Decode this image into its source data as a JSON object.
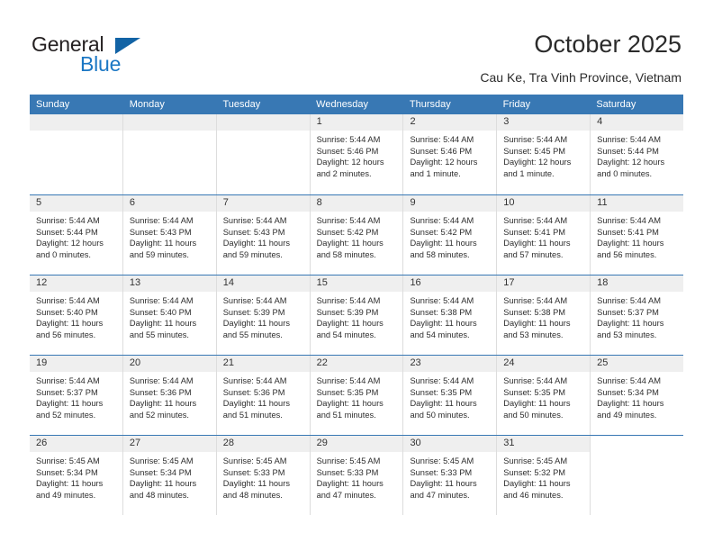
{
  "brand": {
    "name_part1": "General",
    "name_part2": "Blue",
    "triangle_icon": "triangle-icon",
    "accent_color": "#1b77c4"
  },
  "header": {
    "title": "October 2025",
    "subtitle": "Cau Ke, Tra Vinh Province, Vietnam"
  },
  "calendar": {
    "header_bg_color": "#3878b4",
    "date_band_color": "#efefef",
    "weekday_headers": [
      "Sunday",
      "Monday",
      "Tuesday",
      "Wednesday",
      "Thursday",
      "Friday",
      "Saturday"
    ],
    "weeks": [
      [
        {
          "day": "",
          "empty": true,
          "shaded": true
        },
        {
          "day": "",
          "empty": true,
          "shaded": true
        },
        {
          "day": "",
          "empty": true,
          "shaded": true
        },
        {
          "day": "1",
          "sunrise": "Sunrise: 5:44 AM",
          "sunset": "Sunset: 5:46 PM",
          "daylight": "Daylight: 12 hours and 2 minutes."
        },
        {
          "day": "2",
          "sunrise": "Sunrise: 5:44 AM",
          "sunset": "Sunset: 5:46 PM",
          "daylight": "Daylight: 12 hours and 1 minute."
        },
        {
          "day": "3",
          "sunrise": "Sunrise: 5:44 AM",
          "sunset": "Sunset: 5:45 PM",
          "daylight": "Daylight: 12 hours and 1 minute."
        },
        {
          "day": "4",
          "sunrise": "Sunrise: 5:44 AM",
          "sunset": "Sunset: 5:44 PM",
          "daylight": "Daylight: 12 hours and 0 minutes."
        }
      ],
      [
        {
          "day": "5",
          "sunrise": "Sunrise: 5:44 AM",
          "sunset": "Sunset: 5:44 PM",
          "daylight": "Daylight: 12 hours and 0 minutes."
        },
        {
          "day": "6",
          "sunrise": "Sunrise: 5:44 AM",
          "sunset": "Sunset: 5:43 PM",
          "daylight": "Daylight: 11 hours and 59 minutes."
        },
        {
          "day": "7",
          "sunrise": "Sunrise: 5:44 AM",
          "sunset": "Sunset: 5:43 PM",
          "daylight": "Daylight: 11 hours and 59 minutes."
        },
        {
          "day": "8",
          "sunrise": "Sunrise: 5:44 AM",
          "sunset": "Sunset: 5:42 PM",
          "daylight": "Daylight: 11 hours and 58 minutes."
        },
        {
          "day": "9",
          "sunrise": "Sunrise: 5:44 AM",
          "sunset": "Sunset: 5:42 PM",
          "daylight": "Daylight: 11 hours and 58 minutes."
        },
        {
          "day": "10",
          "sunrise": "Sunrise: 5:44 AM",
          "sunset": "Sunset: 5:41 PM",
          "daylight": "Daylight: 11 hours and 57 minutes."
        },
        {
          "day": "11",
          "sunrise": "Sunrise: 5:44 AM",
          "sunset": "Sunset: 5:41 PM",
          "daylight": "Daylight: 11 hours and 56 minutes."
        }
      ],
      [
        {
          "day": "12",
          "sunrise": "Sunrise: 5:44 AM",
          "sunset": "Sunset: 5:40 PM",
          "daylight": "Daylight: 11 hours and 56 minutes."
        },
        {
          "day": "13",
          "sunrise": "Sunrise: 5:44 AM",
          "sunset": "Sunset: 5:40 PM",
          "daylight": "Daylight: 11 hours and 55 minutes."
        },
        {
          "day": "14",
          "sunrise": "Sunrise: 5:44 AM",
          "sunset": "Sunset: 5:39 PM",
          "daylight": "Daylight: 11 hours and 55 minutes."
        },
        {
          "day": "15",
          "sunrise": "Sunrise: 5:44 AM",
          "sunset": "Sunset: 5:39 PM",
          "daylight": "Daylight: 11 hours and 54 minutes."
        },
        {
          "day": "16",
          "sunrise": "Sunrise: 5:44 AM",
          "sunset": "Sunset: 5:38 PM",
          "daylight": "Daylight: 11 hours and 54 minutes."
        },
        {
          "day": "17",
          "sunrise": "Sunrise: 5:44 AM",
          "sunset": "Sunset: 5:38 PM",
          "daylight": "Daylight: 11 hours and 53 minutes."
        },
        {
          "day": "18",
          "sunrise": "Sunrise: 5:44 AM",
          "sunset": "Sunset: 5:37 PM",
          "daylight": "Daylight: 11 hours and 53 minutes."
        }
      ],
      [
        {
          "day": "19",
          "sunrise": "Sunrise: 5:44 AM",
          "sunset": "Sunset: 5:37 PM",
          "daylight": "Daylight: 11 hours and 52 minutes."
        },
        {
          "day": "20",
          "sunrise": "Sunrise: 5:44 AM",
          "sunset": "Sunset: 5:36 PM",
          "daylight": "Daylight: 11 hours and 52 minutes."
        },
        {
          "day": "21",
          "sunrise": "Sunrise: 5:44 AM",
          "sunset": "Sunset: 5:36 PM",
          "daylight": "Daylight: 11 hours and 51 minutes."
        },
        {
          "day": "22",
          "sunrise": "Sunrise: 5:44 AM",
          "sunset": "Sunset: 5:35 PM",
          "daylight": "Daylight: 11 hours and 51 minutes."
        },
        {
          "day": "23",
          "sunrise": "Sunrise: 5:44 AM",
          "sunset": "Sunset: 5:35 PM",
          "daylight": "Daylight: 11 hours and 50 minutes."
        },
        {
          "day": "24",
          "sunrise": "Sunrise: 5:44 AM",
          "sunset": "Sunset: 5:35 PM",
          "daylight": "Daylight: 11 hours and 50 minutes."
        },
        {
          "day": "25",
          "sunrise": "Sunrise: 5:44 AM",
          "sunset": "Sunset: 5:34 PM",
          "daylight": "Daylight: 11 hours and 49 minutes."
        }
      ],
      [
        {
          "day": "26",
          "sunrise": "Sunrise: 5:45 AM",
          "sunset": "Sunset: 5:34 PM",
          "daylight": "Daylight: 11 hours and 49 minutes."
        },
        {
          "day": "27",
          "sunrise": "Sunrise: 5:45 AM",
          "sunset": "Sunset: 5:34 PM",
          "daylight": "Daylight: 11 hours and 48 minutes."
        },
        {
          "day": "28",
          "sunrise": "Sunrise: 5:45 AM",
          "sunset": "Sunset: 5:33 PM",
          "daylight": "Daylight: 11 hours and 48 minutes."
        },
        {
          "day": "29",
          "sunrise": "Sunrise: 5:45 AM",
          "sunset": "Sunset: 5:33 PM",
          "daylight": "Daylight: 11 hours and 47 minutes."
        },
        {
          "day": "30",
          "sunrise": "Sunrise: 5:45 AM",
          "sunset": "Sunset: 5:33 PM",
          "daylight": "Daylight: 11 hours and 47 minutes."
        },
        {
          "day": "31",
          "sunrise": "Sunrise: 5:45 AM",
          "sunset": "Sunset: 5:32 PM",
          "daylight": "Daylight: 11 hours and 46 minutes."
        },
        {
          "day": "",
          "empty": true,
          "shaded": false
        }
      ]
    ]
  }
}
